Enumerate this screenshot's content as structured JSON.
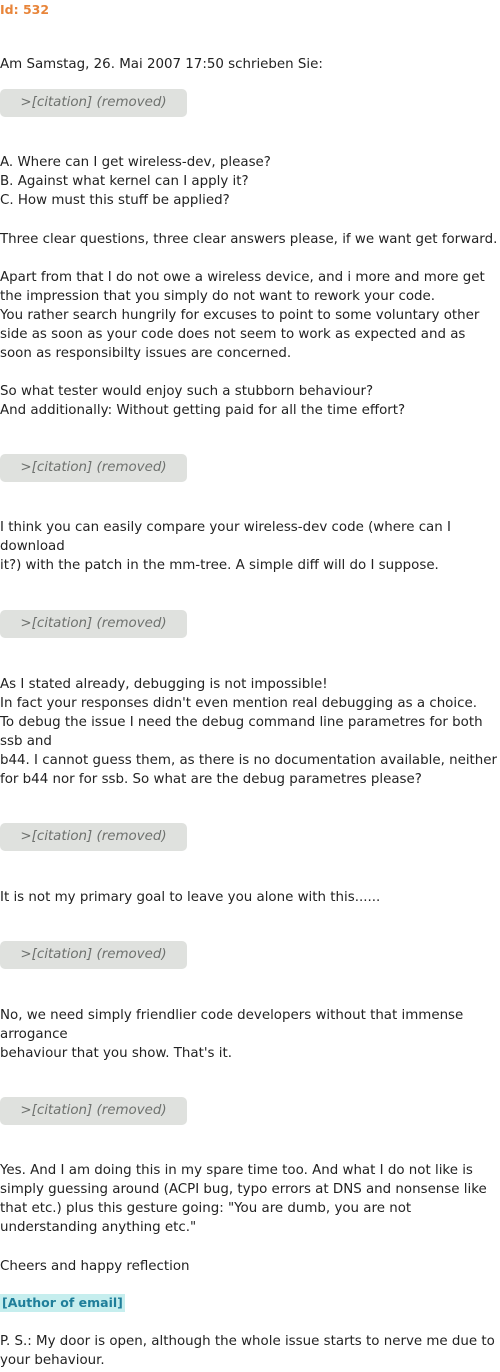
{
  "email": {
    "id": "Id: 532",
    "header": "Am Samstag, 26. Mai 2007 17:50 schrieben Sie:",
    "citation_label": ">[citation] (removed)",
    "questions": "A. Where can I get wireless-dev, please?\nB. Against what kernel can I apply it?\nC. How must this stuff be applied?",
    "clear_answers": "Three clear questions, three clear answers please, if we want get forward.",
    "apart_from": "Apart from that I do not owe a wireless device, and i more and more get the impression that you simply do not want to rework your code.\nYou rather search hungrily for excuses to point to some voluntary other side as soon as your code does not seem to work as expected and as soon as responsibilty issues are concerned.",
    "tester": "So what tester would enjoy such a stubborn behaviour?\nAnd additionally: Without getting paid for all the time effort?",
    "compare": "I think you can easily compare your wireless-dev code (where can I download\nit?) with the patch in the mm-tree. A simple diff will do I suppose.",
    "debugging": "As I stated already, debugging is not impossible!\nIn fact your responses didn't even mention real debugging as a choice.\nTo debug the issue I need the debug command line parametres for both ssb and\nb44. I cannot guess them, as there is no documentation available, neither for b44 nor for ssb. So what are the debug parametres please?",
    "primary_goal": "It is not my primary goal to leave you alone with this......",
    "friendlier": "No, we need simply friendlier code developers without that immense arrogance\nbehaviour that you show. That's it.",
    "spare_time": "Yes. And I am doing this in my spare time too. And what I do not like is simply guessing around (ACPI bug, typo errors at DNS and nonsense like that etc.) plus this gesture going: \"You are dumb, you are not understanding anything etc.\"",
    "cheers": "Cheers and happy reflection",
    "author": "[Author of email]",
    "ps": "P. S.: My door is open, although the whole issue starts to nerve me due to your behaviour."
  },
  "colors": {
    "id_orange": "#e8853a",
    "citation_bg": "#dfe1de",
    "citation_text": "#6e716e",
    "author_bg": "#c6eeee",
    "author_text": "#1f7e9a",
    "body_text": "#222222"
  }
}
